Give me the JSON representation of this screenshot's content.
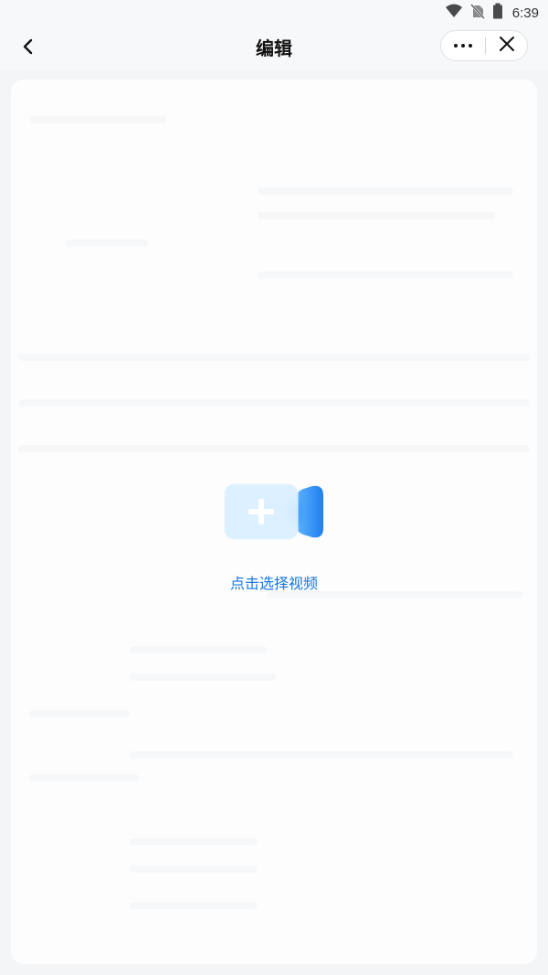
{
  "status_bar": {
    "time": "6:39",
    "icons": [
      "wifi-icon",
      "no-sim-icon",
      "battery-icon"
    ]
  },
  "nav": {
    "title": "编辑",
    "back_icon": "chevron-left-icon",
    "more_icon": "more-dots-icon",
    "close_icon": "close-icon"
  },
  "upload": {
    "icon": "add-video-icon",
    "label": "点击选择视频"
  },
  "colors": {
    "accent": "#1677e6",
    "camera_light": "#d9efff",
    "camera_blue": "#2b8cf2",
    "page_bg": "#f4f5f7",
    "card_bg": "#fdfdfe"
  }
}
